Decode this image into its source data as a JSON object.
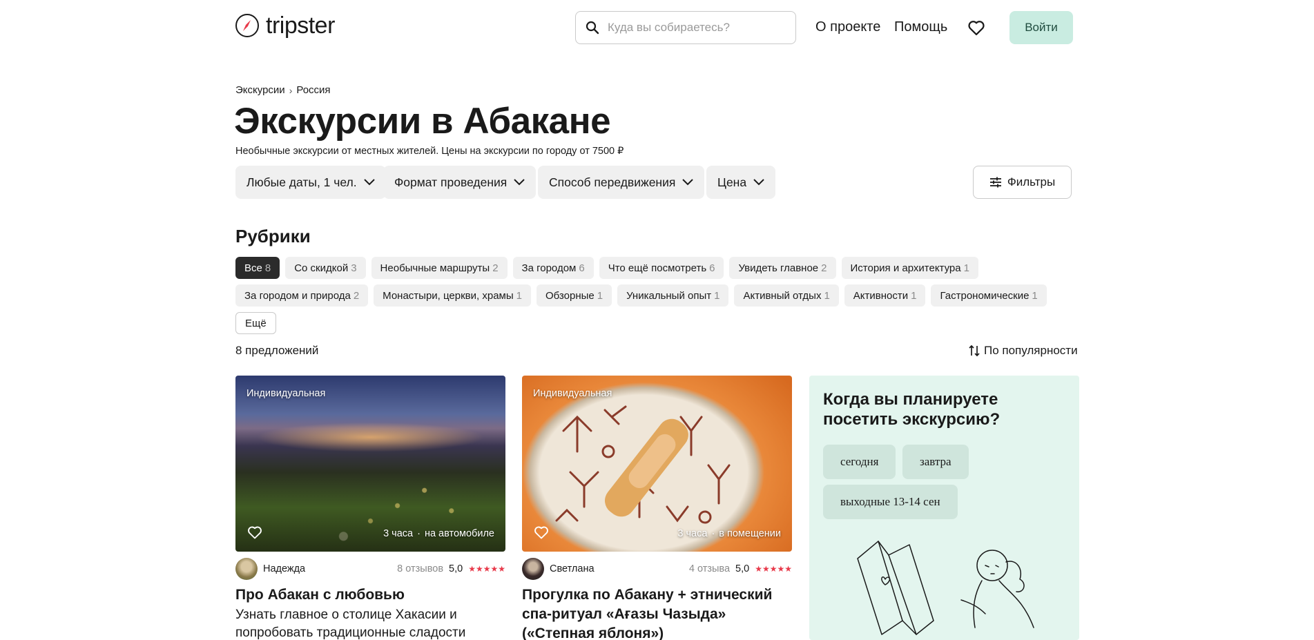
{
  "header": {
    "logo_text": "tripster",
    "search_placeholder": "Куда вы собираетесь?",
    "nav": [
      "О проекте",
      "Помощь"
    ],
    "login_label": "Войти",
    "login_bg": "#c9ece1"
  },
  "breadcrumb": [
    "Экскурсии",
    "Россия"
  ],
  "page_title": "Экскурсии в Абакане",
  "subtitle": "Необычные экскурсии от местных жителей. Цены на экскурсии по городу от 7500 ₽",
  "filters": [
    "Любые даты, 1 чел.",
    "Формат проведения",
    "Способ передвижения",
    "Цена"
  ],
  "filters_button": "Фильтры",
  "rubrics": {
    "title": "Рубрики",
    "row1": [
      {
        "label": "Все",
        "count": "8"
      },
      {
        "label": "Со скидкой",
        "count": "3"
      },
      {
        "label": "Необычные маршруты",
        "count": "2"
      },
      {
        "label": "За городом",
        "count": "6"
      },
      {
        "label": "Что ещё посмотреть",
        "count": "6"
      },
      {
        "label": "Увидеть главное",
        "count": "2"
      },
      {
        "label": "История и архитектура",
        "count": "1"
      }
    ],
    "row2": [
      {
        "label": "За городом и природа",
        "count": "2"
      },
      {
        "label": "Монастыри, церкви, храмы",
        "count": "1"
      },
      {
        "label": "Обзорные",
        "count": "1"
      },
      {
        "label": "Уникальный опыт",
        "count": "1"
      },
      {
        "label": "Активный отдых",
        "count": "1"
      },
      {
        "label": "Активности",
        "count": "1"
      },
      {
        "label": "Гастрономические",
        "count": "1"
      }
    ],
    "more_label": "Ещё"
  },
  "offers_count": "8 предложений",
  "sort_label": "По популярности",
  "cards": [
    {
      "badge": "Индивидуальная",
      "duration": "3 часа",
      "transport": "на автомобиле",
      "author": "Надежда",
      "reviews": "8 отзывов",
      "rating": "5,0",
      "stars": "★★★★★",
      "title": "Про Абакан с любовью",
      "desc": "Узнать главное о столице Хакасии и попробовать традиционные сладости"
    },
    {
      "badge": "Индивидуальная",
      "duration": "3 часа",
      "transport": "в помещении",
      "author": "Светлана",
      "reviews": "4 отзыва",
      "rating": "5,0",
      "stars": "★★★★★",
      "title": "Прогулка по Абакану + этнический спа-ритуал «Ағазы Чазыда» («Степная яблоня»)",
      "desc": ""
    }
  ],
  "plan": {
    "title": "Когда вы планируете посетить экскурсию?",
    "options": [
      "сегодня",
      "завтра",
      "выходные 13-14 сен"
    ]
  },
  "colors": {
    "star": "#e8394a",
    "plan_bg": "#e3f5ee",
    "active_chip": "#2b2b2b"
  }
}
